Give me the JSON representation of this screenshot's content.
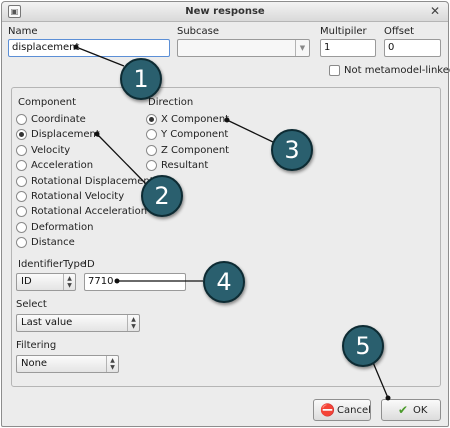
{
  "window": {
    "title": "New response",
    "app_icon": "app-icon",
    "close_glyph": "✕"
  },
  "top": {
    "name_label": "Name",
    "name_value": "displacement",
    "subcase_label": "Subcase",
    "subcase_value": "",
    "multiplier_label": "Multipiler",
    "multiplier_value": "1",
    "offset_label": "Offset",
    "offset_value": "0",
    "not_metamodel_label": "Not metamodel-linked",
    "not_metamodel_checked": false
  },
  "component": {
    "heading": "Component",
    "options": [
      {
        "label": "Coordinate",
        "checked": false
      },
      {
        "label": "Displacement",
        "checked": true
      },
      {
        "label": "Velocity",
        "checked": false
      },
      {
        "label": "Acceleration",
        "checked": false
      },
      {
        "label": "Rotational Displacement",
        "checked": false
      },
      {
        "label": "Rotational Velocity",
        "checked": false
      },
      {
        "label": "Rotational Acceleration",
        "checked": false
      },
      {
        "label": "Deformation",
        "checked": false
      },
      {
        "label": "Distance",
        "checked": false
      }
    ]
  },
  "direction": {
    "heading": "Direction",
    "options": [
      {
        "label": "X Component",
        "checked": true
      },
      {
        "label": "Y Component",
        "checked": false
      },
      {
        "label": "Z Component",
        "checked": false
      },
      {
        "label": "Resultant",
        "checked": false
      }
    ]
  },
  "identifier": {
    "type_label": "IdentifierType",
    "type_value": "ID",
    "id_label": "ID",
    "id_value": "7710"
  },
  "select": {
    "label": "Select",
    "value": "Last value"
  },
  "filtering": {
    "label": "Filtering",
    "value": "None"
  },
  "buttons": {
    "cancel_label": "Cancel",
    "ok_label": "OK"
  },
  "callouts": [
    "1",
    "2",
    "3",
    "4",
    "5"
  ],
  "colors": {
    "callout_fill": "#2a5f6e",
    "callout_border": "#0d2b33",
    "cancel_icon": "#c62828",
    "ok_icon": "#4a9a2a"
  }
}
